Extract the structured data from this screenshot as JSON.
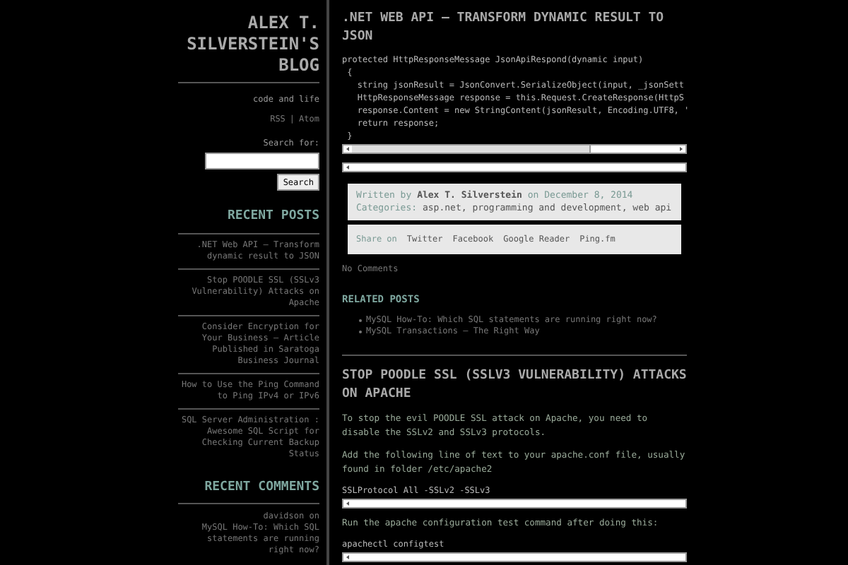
{
  "sidebar": {
    "blog_title": "ALEX T. SILVERSTEIN'S BLOG",
    "tagline": "code and life",
    "feeds": [
      {
        "label": "RSS"
      },
      {
        "label": "Atom"
      }
    ],
    "feed_separator": "|",
    "search": {
      "label": "Search for:",
      "button": "Search"
    },
    "recent_posts": {
      "heading": "RECENT POSTS",
      "items": [
        ".NET Web API – Transform dynamic result to JSON",
        "Stop POODLE SSL (SSLv3 Vulnerability) Attacks on Apache",
        "Consider Encryption for Your Business – Article Published in Saratoga Business Journal",
        "How to Use the Ping Command to Ping IPv4 or IPv6",
        "SQL Server Administration : Awesome SQL Script for Checking Current Backup Status"
      ]
    },
    "recent_comments": {
      "heading": "RECENT COMMENTS",
      "items": [
        {
          "author": "davidson",
          "connector": "on",
          "post": "MySQL How-To: Which SQL statements are running right now?"
        }
      ]
    }
  },
  "posts": [
    {
      "title": ".NET WEB API – TRANSFORM DYNAMIC RESULT TO JSON",
      "blocks": [
        {
          "kind": "code",
          "lines": [
            "protected HttpResponseMessage JsonApiRespond(dynamic input)",
            " {",
            "   string jsonResult = JsonConvert.SerializeObject(input, _jsonSett",
            "   HttpResponseMessage response = this.Request.CreateResponse(HttpS",
            "   response.Content = new StringContent(jsonResult, Encoding.UTF8, '",
            "   return response;",
            " }"
          ],
          "scroll_thumb": true
        }
      ],
      "meta": {
        "written_by": "Written by",
        "author": "Alex T. Silverstein",
        "on": "on",
        "date": "December 8, 2014",
        "categories_label": "Categories:",
        "categories": "asp.net, programming and development, web api"
      },
      "share": {
        "label": "Share on",
        "links": [
          "Twitter",
          "Facebook",
          "Google Reader",
          "Ping.fm"
        ]
      },
      "comments": "No Comments",
      "related": {
        "heading": "RELATED POSTS",
        "items": [
          "MySQL How-To: Which SQL statements are running right now?",
          "MySQL Transactions – The Right Way"
        ]
      }
    },
    {
      "title": "STOP POODLE SSL (SSLV3 VULNERABILITY) ATTACKS ON APACHE",
      "blocks": [
        {
          "kind": "paragraph",
          "text": "To stop the evil POODLE SSL attack on Apache, you need to disable the SSLv2 and SSLv3 protocols."
        },
        {
          "kind": "paragraph",
          "text": "Add the following line of text to your apache.conf file, usually found in folder /etc/apache2"
        },
        {
          "kind": "code",
          "lines": [
            "SSLProtocol All -SSLv2 -SSLv3"
          ],
          "scroll_thumb": false
        },
        {
          "kind": "paragraph",
          "text": "Run the apache configuration test command after doing this:"
        },
        {
          "kind": "code",
          "lines": [
            "apachectl configtest"
          ],
          "scroll_thumb": false
        }
      ]
    }
  ]
}
